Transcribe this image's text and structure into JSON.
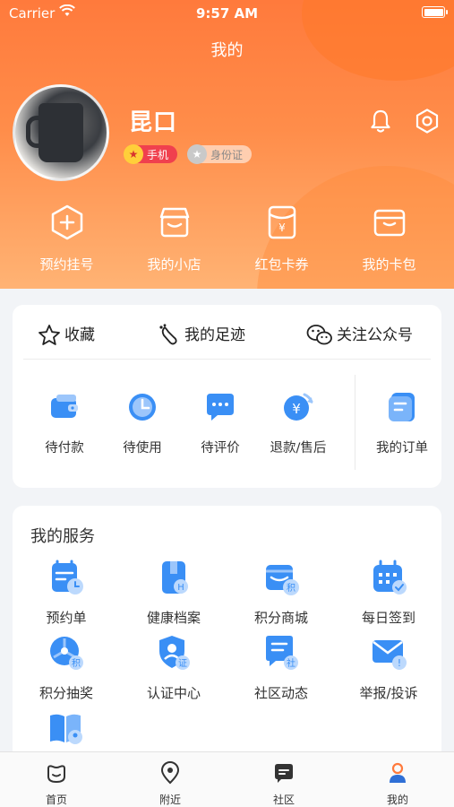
{
  "status_bar": {
    "carrier": "Carrier",
    "time": "9:57 AM"
  },
  "header": {
    "title": "我的",
    "username": "昆口",
    "badges": {
      "phone": "手机",
      "id_card": "身份证"
    }
  },
  "quick_actions": [
    {
      "label": "预约挂号",
      "icon": "plus-hexagon-icon"
    },
    {
      "label": "我的小店",
      "icon": "shop-icon"
    },
    {
      "label": "红包卡券",
      "icon": "red-packet-icon"
    },
    {
      "label": "我的卡包",
      "icon": "wallet-icon"
    }
  ],
  "shortcuts": [
    {
      "label": "收藏",
      "icon": "star-icon"
    },
    {
      "label": "我的足迹",
      "icon": "footprint-icon"
    },
    {
      "label": "关注公众号",
      "icon": "wechat-icon"
    }
  ],
  "orders": [
    {
      "label": "待付款",
      "icon": "wallet-pay-icon"
    },
    {
      "label": "待使用",
      "icon": "clock-icon"
    },
    {
      "label": "待评价",
      "icon": "comment-icon"
    },
    {
      "label": "退款/售后",
      "icon": "refund-icon"
    },
    {
      "label": "我的订单",
      "icon": "order-list-icon"
    }
  ],
  "services": {
    "title": "我的服务",
    "items": [
      {
        "label": "预约单",
        "icon": "appointment-icon"
      },
      {
        "label": "健康档案",
        "icon": "health-record-icon"
      },
      {
        "label": "积分商城",
        "icon": "points-mall-icon"
      },
      {
        "label": "每日签到",
        "icon": "calendar-check-icon"
      },
      {
        "label": "积分抽奖",
        "icon": "points-lottery-icon"
      },
      {
        "label": "认证中心",
        "icon": "certification-icon"
      },
      {
        "label": "社区动态",
        "icon": "community-news-icon"
      },
      {
        "label": "举报/投诉",
        "icon": "report-mail-icon"
      },
      {
        "label": "",
        "icon": "book-user-icon"
      }
    ]
  },
  "tabbar": [
    {
      "label": "首页",
      "icon": "home-icon",
      "active": false
    },
    {
      "label": "附近",
      "icon": "location-pin-icon",
      "active": false
    },
    {
      "label": "社区",
      "icon": "community-icon",
      "active": false
    },
    {
      "label": "我的",
      "icon": "profile-icon",
      "active": true
    }
  ],
  "colors": {
    "brand": "#ff7a3c",
    "accent_blue": "#3a8ff5",
    "badge_red": "#f0404e"
  }
}
